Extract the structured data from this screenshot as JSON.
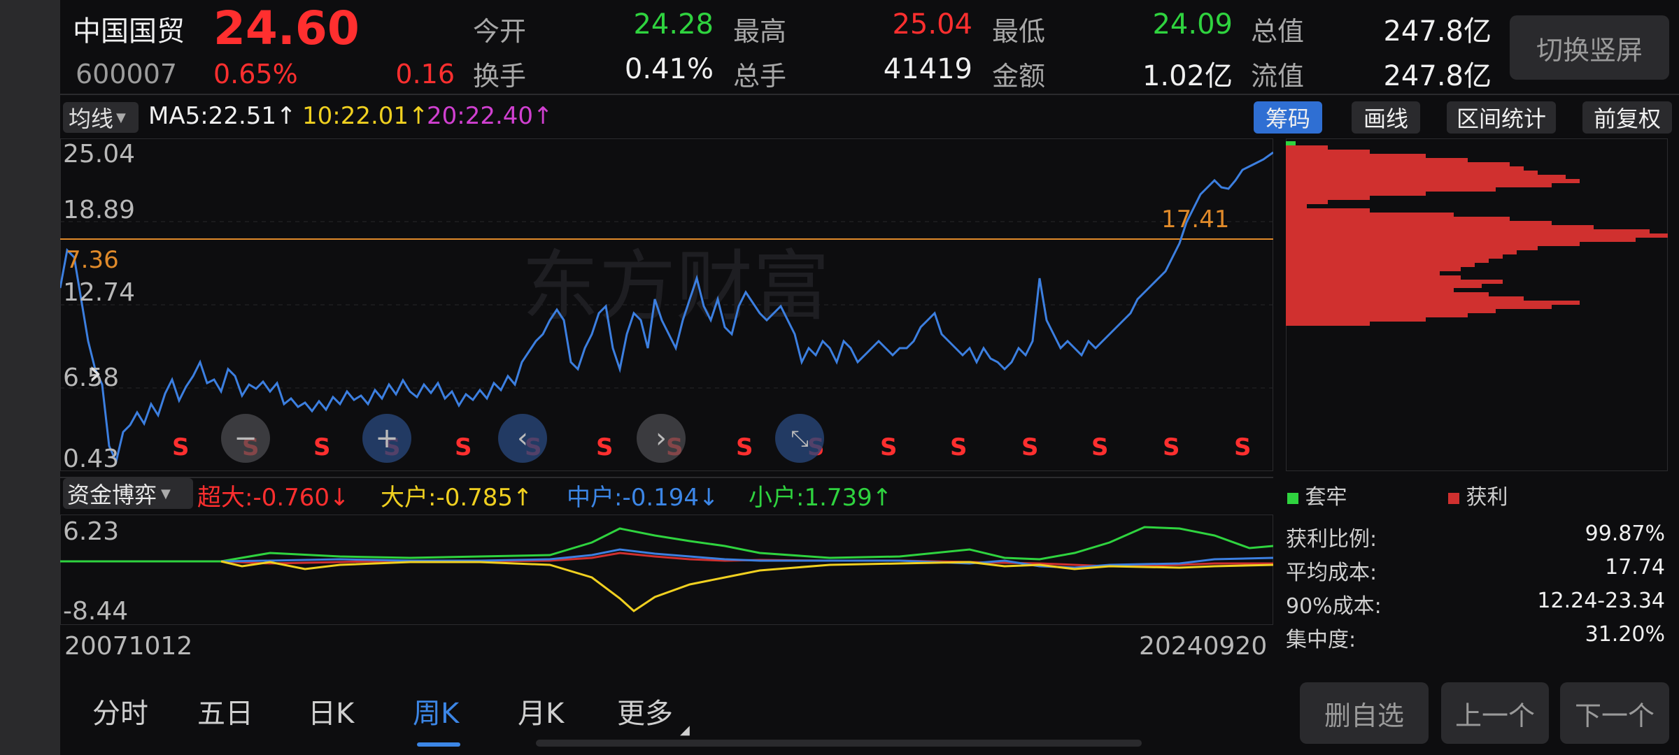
{
  "header": {
    "stock_name": "中国国贸",
    "price": "24.60",
    "code": "600007",
    "change_pct": "0.65%",
    "change_amt": "0.16",
    "stats": [
      {
        "label": "今开",
        "value": "24.28",
        "color": "green"
      },
      {
        "label": "最高",
        "value": "25.04",
        "color": "red"
      },
      {
        "label": "最低",
        "value": "24.09",
        "color": "green"
      },
      {
        "label": "总值",
        "value": "247.8亿",
        "color": "white"
      },
      {
        "label": "换手",
        "value": "0.41%",
        "color": "white"
      },
      {
        "label": "总手",
        "value": "41419",
        "color": "white"
      },
      {
        "label": "金额",
        "value": "1.02亿",
        "color": "white"
      },
      {
        "label": "流值",
        "value": "247.8亿",
        "color": "white"
      }
    ],
    "switch_button": "切换竖屏"
  },
  "ma_bar": {
    "select_label": "均线",
    "ma5": "MA5:22.51↑",
    "ma10": "10:22.01↑",
    "ma20": "20:22.40↑",
    "chips": [
      {
        "label": "筹码",
        "active": true
      },
      {
        "label": "画线",
        "active": false
      },
      {
        "label": "区间统计",
        "active": false
      },
      {
        "label": "前复权",
        "active": false
      }
    ]
  },
  "price_chart": {
    "y_ticks": [
      "25.04",
      "18.89",
      "12.74",
      "6.58",
      "0.43"
    ],
    "ref_line_left": "7.36",
    "ref_line_right": "17.41",
    "s_marker": "S",
    "watermark": "东方财富",
    "controls": [
      "minus-icon",
      "plus-icon",
      "left-icon",
      "right-icon",
      "collapse-icon"
    ]
  },
  "capital_bar": {
    "select_label": "资金博弈",
    "super_large": "超大:-0.760↓",
    "large": "大户:-0.785↑",
    "medium": "中户:-0.194↓",
    "small": "小户:1.739↑"
  },
  "capital_chart": {
    "y_top": "6.23",
    "y_bottom": "-8.44",
    "date_start": "20071012",
    "date_end": "20240920"
  },
  "chip_panel": {
    "legend_trapped": "套牢",
    "legend_profit": "获利",
    "rows": [
      {
        "label": "获利比例:",
        "value": "99.87%"
      },
      {
        "label": "平均成本:",
        "value": "17.74"
      },
      {
        "label": "90%成本:",
        "value": "12.24-23.34"
      },
      {
        "label": "集中度:",
        "value": "31.20%"
      }
    ]
  },
  "tabs": [
    {
      "label": "分时",
      "active": false
    },
    {
      "label": "五日",
      "active": false
    },
    {
      "label": "日K",
      "active": false
    },
    {
      "label": "周K",
      "active": true
    },
    {
      "label": "月K",
      "active": false
    },
    {
      "label": "更多",
      "active": false
    }
  ],
  "bottom_buttons": {
    "remove": "删自选",
    "prev": "上一个",
    "next": "下一个"
  },
  "colors": {
    "up_red": "#ff2f2f",
    "down_green": "#2fd33f",
    "price_line": "#3c7fe0",
    "ma10_yellow": "#f0d020",
    "ma20_magenta": "#d040d0",
    "profit_bar": "#d0302f",
    "accent_blue": "#3c86e6",
    "ref_line": "#e08a2a"
  }
}
